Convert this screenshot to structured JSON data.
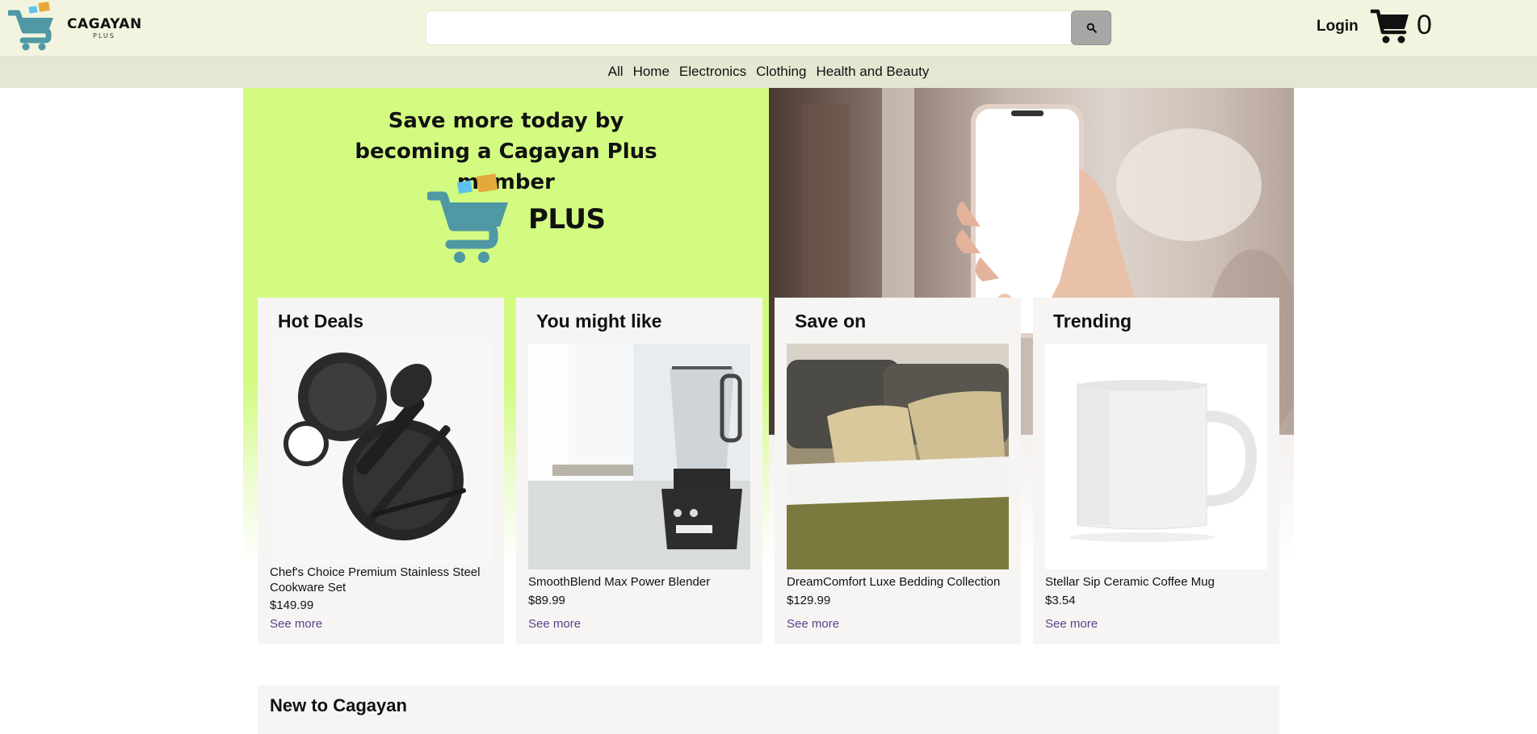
{
  "header": {
    "brand": "CAGAYAN",
    "brand_sub": "PLUS",
    "search_placeholder": "",
    "login": "Login",
    "cart_count": "0"
  },
  "nav": [
    "All",
    "Home",
    "Electronics",
    "Clothing",
    "Health and Beauty"
  ],
  "hero": {
    "title": "Save more today by becoming a Cagayan Plus member",
    "plus_word": "PLUS"
  },
  "cards": [
    {
      "title": "Hot Deals",
      "product": "Chef's Choice Premium Stainless Steel Cookware Set",
      "price": "$149.99",
      "link": "See more"
    },
    {
      "title": "You might like",
      "product": "SmoothBlend Max Power Blender",
      "price": "$89.99",
      "link": "See more"
    },
    {
      "title": "Save on",
      "product": "DreamComfort Luxe Bedding Collection",
      "price": "$129.99",
      "link": "See more"
    },
    {
      "title": "Trending",
      "product": "Stellar Sip Ceramic Coffee Mug",
      "price": "$3.54",
      "link": "See more"
    }
  ],
  "new_section": {
    "title": "New to Cagayan"
  },
  "colors": {
    "topbar": "#f3f4df",
    "navbar": "#e6e7d2",
    "hero_green": "#d3fb82",
    "card_bg": "#f6f5f3",
    "link": "#5b3f8a",
    "logo_teal": "#4f98a4",
    "logo_yellow": "#e5a93b",
    "logo_blue": "#5ec2ea"
  },
  "icons": [
    "cart-logo-icon",
    "search-icon",
    "shopping-cart-icon"
  ]
}
